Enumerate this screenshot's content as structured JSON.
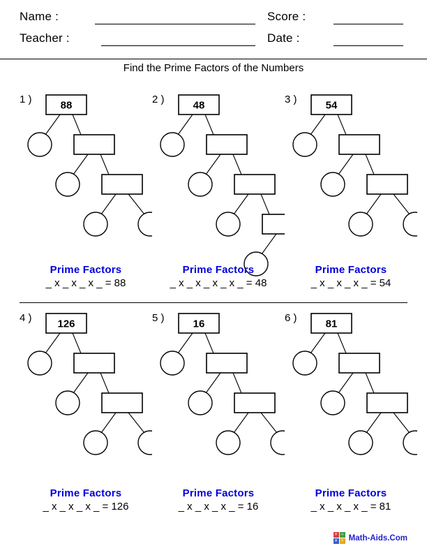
{
  "header": {
    "name_label": "Name :",
    "teacher_label": "Teacher :",
    "score_label": "Score :",
    "date_label": "Date :",
    "name_value": "",
    "teacher_value": "",
    "score_value": "",
    "date_value": ""
  },
  "title": "Find the Prime Factors of the Numbers",
  "answer_title": "Prime Factors",
  "problems": [
    {
      "number_label": "1 )",
      "value": "88",
      "answer_line": "_ x _ x _ x _  = 88",
      "blank_count": 4,
      "tree_levels": 3
    },
    {
      "number_label": "2 )",
      "value": "48",
      "answer_line": "_ x _ x _ x _ x _ = 48",
      "blank_count": 5,
      "tree_levels": 4
    },
    {
      "number_label": "3 )",
      "value": "54",
      "answer_line": "_ x _ x _ x _ = 54",
      "blank_count": 4,
      "tree_levels": 3
    },
    {
      "number_label": "4 )",
      "value": "126",
      "answer_line": "_ x _ x _ x _ = 126",
      "blank_count": 4,
      "tree_levels": 3
    },
    {
      "number_label": "5 )",
      "value": "16",
      "answer_line": "_ x _ x _ x _ = 16",
      "blank_count": 4,
      "tree_levels": 3
    },
    {
      "number_label": "6 )",
      "value": "81",
      "answer_line": "_ x _ x _ x _ = 81",
      "blank_count": 4,
      "tree_levels": 3
    }
  ],
  "footer": {
    "brand": "Math-Aids.Com",
    "logo_symbols": [
      "+",
      "−",
      "×",
      "÷"
    ]
  },
  "colors": {
    "accent_blue": "#0000dd",
    "brand_blue": "#2222cc",
    "ink": "#000000",
    "paper": "#ffffff"
  }
}
